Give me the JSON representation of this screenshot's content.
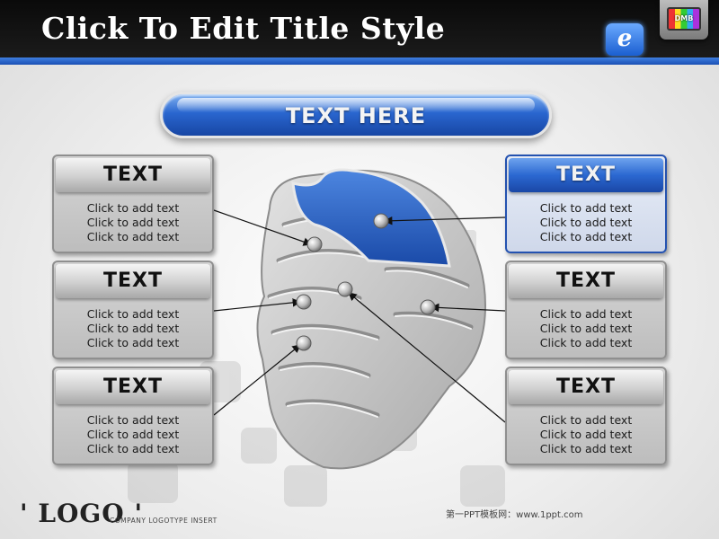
{
  "header": {
    "title": "Click To Edit Title Style",
    "tv_label": "DMB",
    "ie_glyph": "e"
  },
  "banner": {
    "text": "TEXT HERE"
  },
  "cards": [
    {
      "title": "TEXT",
      "lines": [
        "Click to add text",
        "Click to add text",
        "Click to add text"
      ],
      "highlight": false
    },
    {
      "title": "TEXT",
      "lines": [
        "Click to add text",
        "Click to add text",
        "Click to add text"
      ],
      "highlight": false
    },
    {
      "title": "TEXT",
      "lines": [
        "Click to add text",
        "Click to add text",
        "Click to add text"
      ],
      "highlight": false
    },
    {
      "title": "TEXT",
      "lines": [
        "Click to add text",
        "Click to add text",
        "Click to add text"
      ],
      "highlight": true
    },
    {
      "title": "TEXT",
      "lines": [
        "Click to add text",
        "Click to add text",
        "Click to add text"
      ],
      "highlight": false
    },
    {
      "title": "TEXT",
      "lines": [
        "Click to add text",
        "Click to add text",
        "Click to add text"
      ],
      "highlight": false
    }
  ],
  "footer": {
    "logo": "' LOGO '",
    "logo_tagline": "COMPANY LOGOTYPE INSERT",
    "credit": "第一PPT模板网：www.1ppt.com"
  },
  "colors": {
    "accent_blue": "#2a66cf",
    "header_black": "#111111",
    "card_gray": "#c8c8c8"
  },
  "icons": [
    "ie-icon",
    "tv-icon",
    "head-graphic"
  ]
}
